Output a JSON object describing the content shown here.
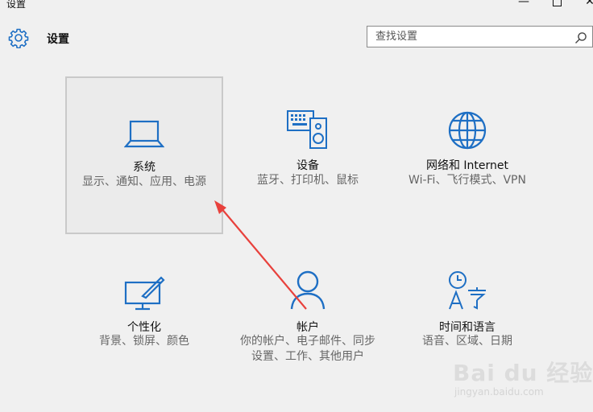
{
  "window": {
    "title": "设置",
    "minimize": "—",
    "close": "✕"
  },
  "header": {
    "title": "设置",
    "search_placeholder": "查找设置"
  },
  "tiles": [
    {
      "name": "系统",
      "desc": "显示、通知、应用、电源",
      "icon": "laptop-icon",
      "selected": true
    },
    {
      "name": "设备",
      "desc": "蓝牙、打印机、鼠标",
      "icon": "devices-icon"
    },
    {
      "name": "网络和 Internet",
      "desc": "Wi-Fi、飞行模式、VPN",
      "icon": "globe-icon"
    },
    {
      "name": "个性化",
      "desc": "背景、锁屏、颜色",
      "icon": "personalization-icon"
    },
    {
      "name": "帐户",
      "desc": "你的帐户、电子邮件、同步设置、工作、其他用户",
      "icon": "person-icon"
    },
    {
      "name": "时间和语言",
      "desc": "语音、区域、日期",
      "icon": "time-language-icon"
    }
  ],
  "watermark": {
    "main": "Bai du 经验",
    "sub": "jingyan.baidu.com"
  },
  "colors": {
    "accent": "#1e6fc4",
    "background": "#f0f0f0",
    "annotation_arrow": "#e8413c"
  }
}
